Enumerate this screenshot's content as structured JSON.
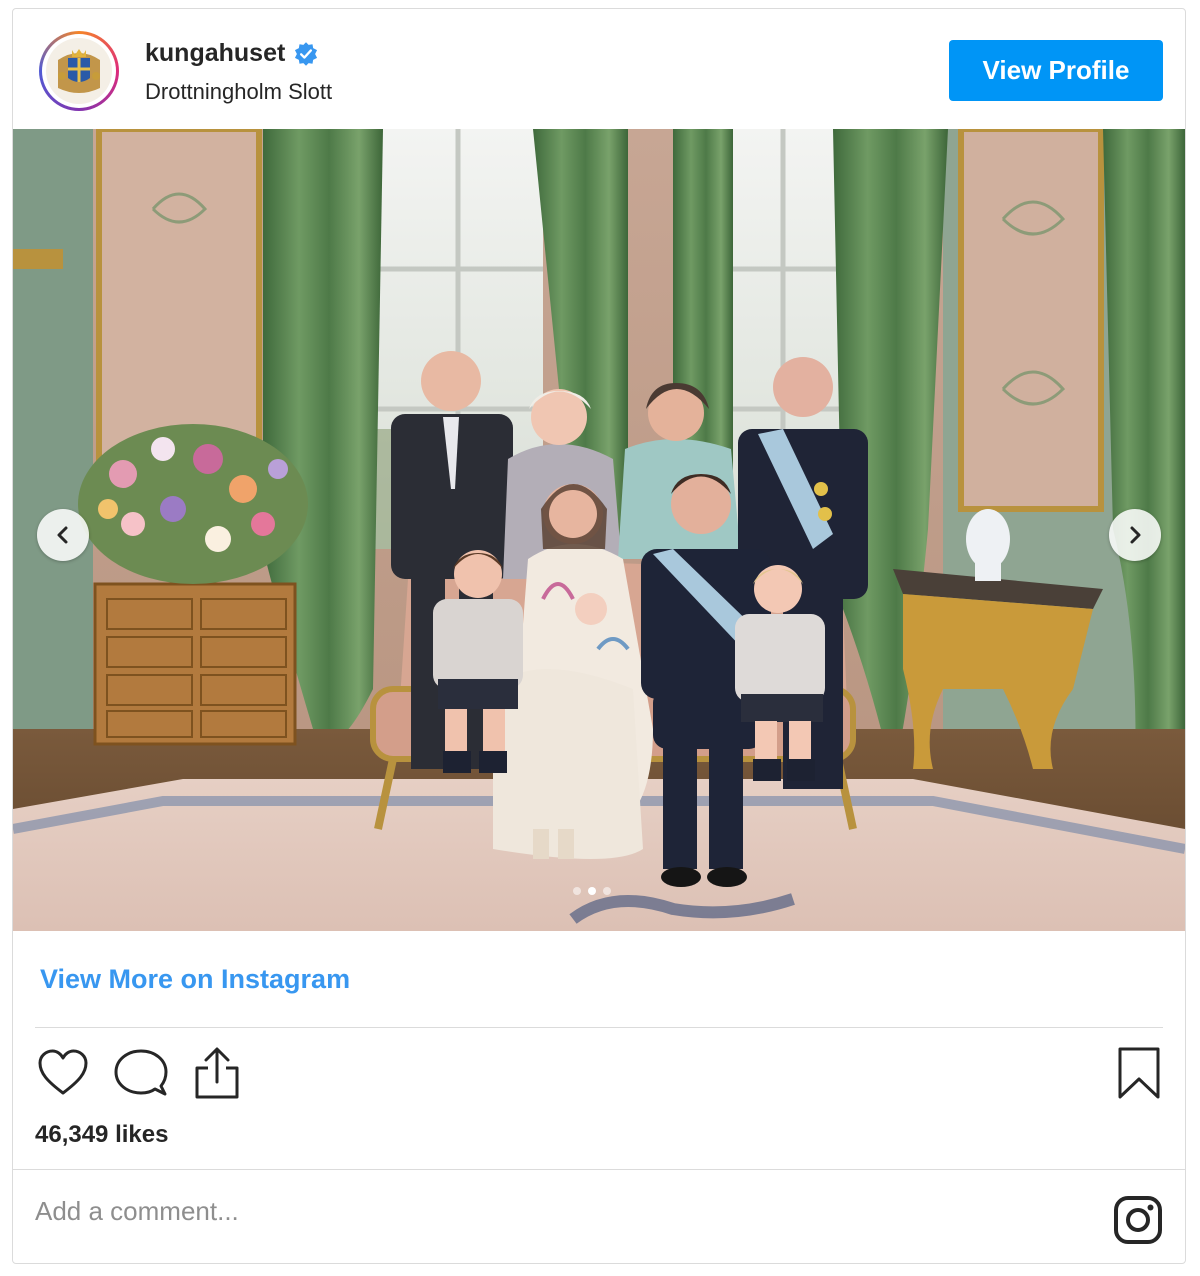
{
  "header": {
    "username": "kungahuset",
    "verified_icon": "verified-badge-icon",
    "location": "Drottningholm Slott",
    "view_profile_label": "View Profile"
  },
  "photo": {
    "prev_icon": "chevron-left-icon",
    "next_icon": "chevron-right-icon",
    "carousel": {
      "count": 3,
      "active_index": 1
    }
  },
  "view_more_label": "View More on Instagram",
  "actions": {
    "like_icon": "heart-icon",
    "comment_icon": "comment-bubble-icon",
    "share_icon": "share-upload-icon",
    "save_icon": "bookmark-icon"
  },
  "likes_text": "46,349 likes",
  "comment": {
    "placeholder": "Add a comment..."
  },
  "colors": {
    "accent": "#0095f6",
    "link": "#3897f0",
    "border": "#dbdbdb"
  }
}
